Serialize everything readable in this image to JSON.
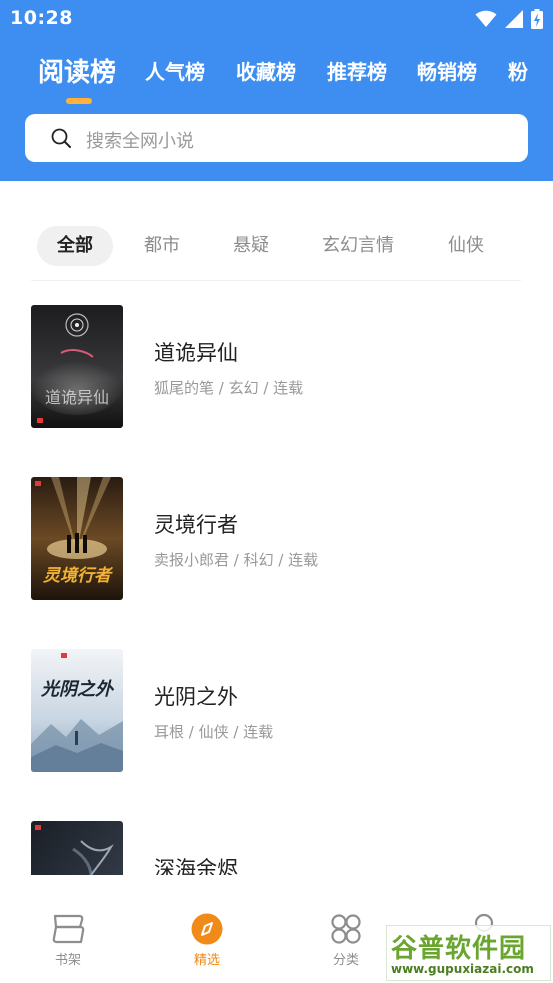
{
  "status_bar": {
    "time": "10:28",
    "icons": [
      "wifi-icon",
      "signal-icon",
      "battery-charging-icon"
    ]
  },
  "tabs": [
    {
      "label": "阅读榜",
      "active": true
    },
    {
      "label": "人气榜",
      "active": false
    },
    {
      "label": "收藏榜",
      "active": false
    },
    {
      "label": "推荐榜",
      "active": false
    },
    {
      "label": "畅销榜",
      "active": false
    },
    {
      "label": "粉",
      "active": false
    }
  ],
  "search": {
    "placeholder": "搜索全网小说"
  },
  "categories": [
    {
      "label": "全部",
      "active": true
    },
    {
      "label": "都市",
      "active": false
    },
    {
      "label": "悬疑",
      "active": false
    },
    {
      "label": "玄幻言情",
      "active": false
    },
    {
      "label": "仙侠",
      "active": false
    }
  ],
  "books": [
    {
      "title": "道诡异仙",
      "meta": "狐尾的笔 / 玄幻 / 连载",
      "cover_text": "道诡异仙"
    },
    {
      "title": "灵境行者",
      "meta": "卖报小郎君 / 科幻 / 连载",
      "cover_text": "灵境行者"
    },
    {
      "title": "光阴之外",
      "meta": "耳根 / 仙侠 / 连载",
      "cover_text": "光阴之外"
    },
    {
      "title": "深海余烬",
      "meta": "",
      "cover_text": ""
    }
  ],
  "bottom_nav": [
    {
      "label": "书架",
      "icon": "bookshelf-icon",
      "active": false
    },
    {
      "label": "精选",
      "icon": "compass-icon",
      "active": true
    },
    {
      "label": "分类",
      "icon": "grid-icon",
      "active": false
    },
    {
      "label": "",
      "icon": "profile-icon",
      "active": false
    }
  ],
  "watermark": {
    "main": "谷普软件园",
    "url": "www.gupuxiazai.com"
  },
  "colors": {
    "header_blue": "#3d8ef0",
    "accent_orange": "#f08a19",
    "indicator": "#ffb13b"
  }
}
